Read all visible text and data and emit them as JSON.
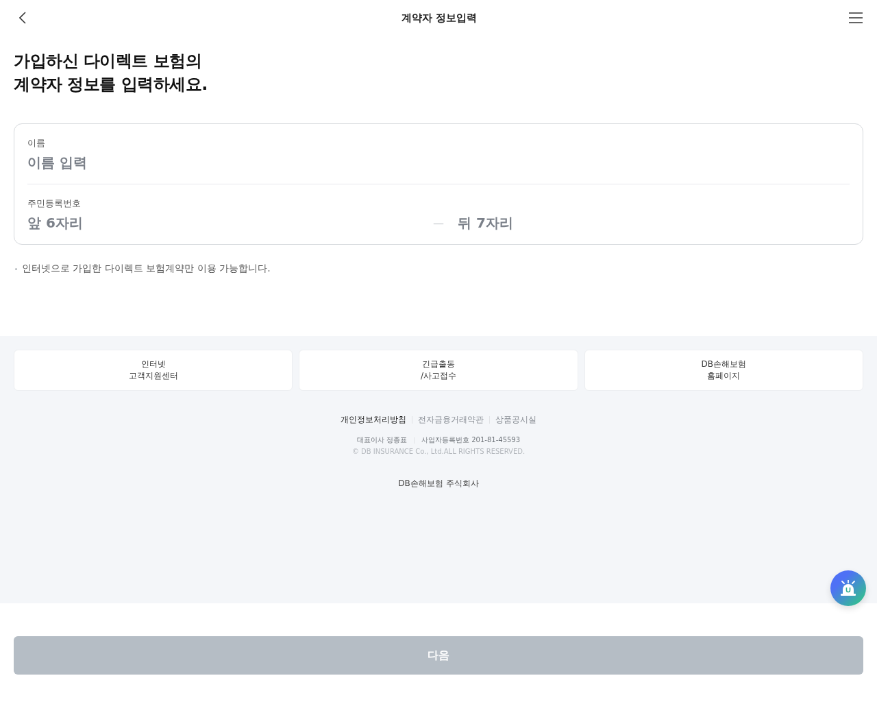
{
  "header": {
    "title": "계약자 정보입력"
  },
  "heading": [
    "가입하신 다이렉트 보험의",
    "계약자 정보를 입력하세요."
  ],
  "form": {
    "fields": [
      {
        "kind": "single",
        "label": "이름",
        "inputs": [
          {
            "placeholder": "이름 입력"
          }
        ]
      },
      {
        "kind": "split",
        "label": "주민등록번호",
        "separator": "—",
        "inputs": [
          {
            "placeholder": "앞 6자리"
          },
          {
            "placeholder": "뒤 7자리"
          }
        ]
      }
    ]
  },
  "note": "인터넷으로 가입한 다이렉트 보험계약만 이용 가능합니다.",
  "footer": {
    "shortcuts": [
      {
        "lines": [
          "인터넷",
          "고객지원센터"
        ]
      },
      {
        "lines": [
          "긴급출동",
          "/사고접수"
        ]
      },
      {
        "lines": [
          "DB손해보험",
          "홈페이지"
        ]
      }
    ],
    "links": [
      {
        "label": "개인정보처리방침",
        "emphasized": true
      },
      {
        "label": "전자금융거래약관",
        "emphasized": false
      },
      {
        "label": "상품공시실",
        "emphasized": false
      }
    ],
    "company_info": [
      "대표이사 정종표",
      "사업자등록번호 201-81-45593"
    ],
    "copyright": "© DB INSURANCE Co., Ltd.ALL RIGHTS RESERVED.",
    "company_name": "DB손해보험 주식회사"
  },
  "next_button": {
    "label": "다음",
    "disabled": true
  }
}
